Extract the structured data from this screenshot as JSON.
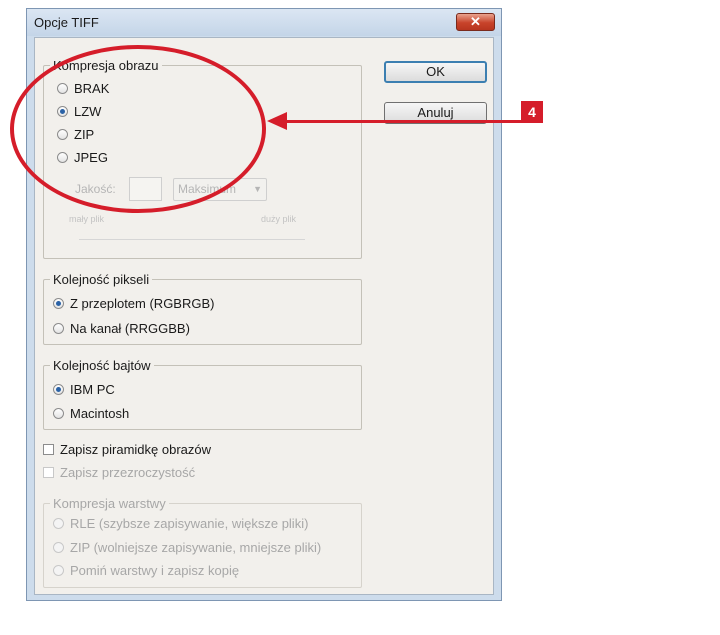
{
  "dialog": {
    "title": "Opcje TIFF",
    "close_label": "✕",
    "ok_label": "OK",
    "cancel_label": "Anuluj"
  },
  "image_compression": {
    "legend": "Kompresja obrazu",
    "options": [
      {
        "label": "BRAK",
        "selected": false
      },
      {
        "label": "LZW",
        "selected": true
      },
      {
        "label": "ZIP",
        "selected": false
      },
      {
        "label": "JPEG",
        "selected": false
      }
    ],
    "quality_label": "Jakość:",
    "quality_value": "",
    "quality_preset": "Maksimum",
    "small_file_label": "mały plik",
    "large_file_label": "duży plik"
  },
  "pixel_order": {
    "legend": "Kolejność pikseli",
    "options": [
      {
        "label": "Z przeplotem (RGBRGB)",
        "selected": true
      },
      {
        "label": "Na kanał (RRGGBB)",
        "selected": false
      }
    ]
  },
  "byte_order": {
    "legend": "Kolejność bajtów",
    "options": [
      {
        "label": "IBM PC",
        "selected": true
      },
      {
        "label": "Macintosh",
        "selected": false
      }
    ]
  },
  "save_pyramid": {
    "label": "Zapisz piramidkę obrazów",
    "checked": false
  },
  "save_transparency": {
    "label": "Zapisz przezroczystość",
    "checked": false,
    "disabled": true
  },
  "layer_compression": {
    "legend": "Kompresja warstwy",
    "disabled": true,
    "options": [
      {
        "label": "RLE (szybsze zapisywanie, większe pliki)"
      },
      {
        "label": "ZIP (wolniejsze zapisywanie, mniejsze pliki)"
      },
      {
        "label": "Pomiń warstwy i zapisz kopię"
      }
    ]
  },
  "callout": {
    "number": "4",
    "color": "#d51d2a"
  }
}
